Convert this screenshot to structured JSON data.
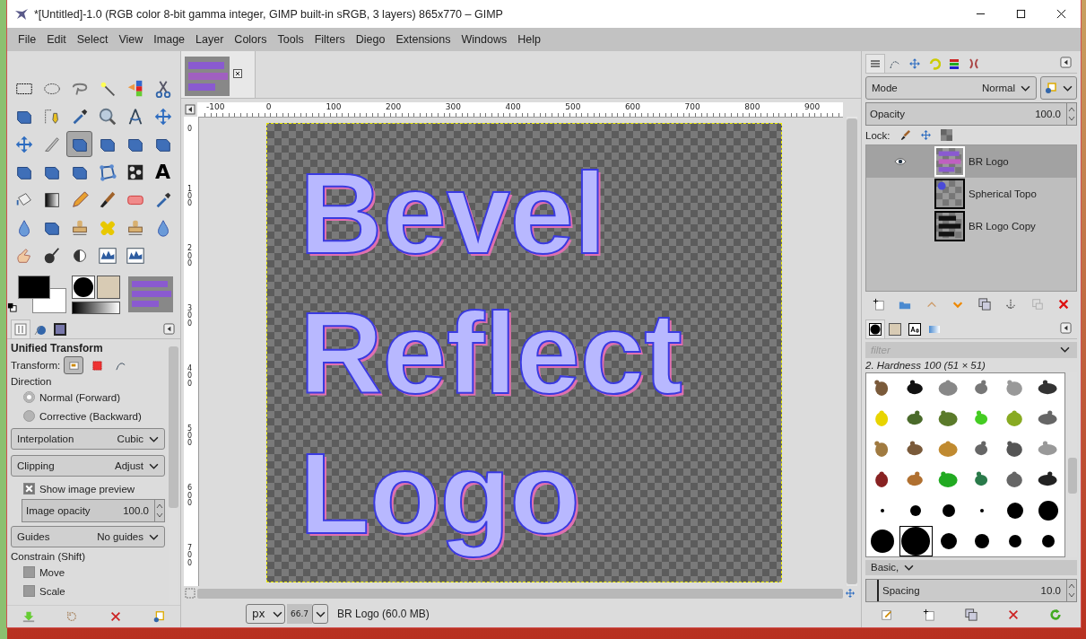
{
  "window": {
    "title": "*[Untitled]-1.0 (RGB color 8-bit gamma integer, GIMP built-in sRGB, 3 layers) 865x770 – GIMP"
  },
  "menu": [
    "File",
    "Edit",
    "Select",
    "View",
    "Image",
    "Layer",
    "Colors",
    "Tools",
    "Filters",
    "Diego",
    "Extensions",
    "Windows",
    "Help"
  ],
  "toolbox": {
    "tools": [
      {
        "selected": false
      },
      {
        "selected": false
      },
      {
        "selected": false
      },
      {
        "selected": false
      },
      {
        "selected": false
      },
      {
        "selected": false
      },
      {
        "selected": false
      },
      {
        "selected": false
      },
      {
        "selected": false
      },
      {
        "selected": false
      },
      {
        "selected": false
      },
      {
        "selected": false
      },
      {
        "selected": false
      },
      {
        "selected": false
      },
      {
        "selected": true
      },
      {
        "selected": false
      },
      {
        "selected": false
      },
      {
        "selected": false
      },
      {
        "selected": false
      },
      {
        "selected": false
      },
      {
        "selected": false
      },
      {
        "selected": false
      },
      {
        "selected": false
      },
      {
        "selected": false,
        "label": "A"
      },
      {
        "selected": false
      },
      {
        "selected": false
      },
      {
        "selected": false
      },
      {
        "selected": false
      },
      {
        "selected": false
      },
      {
        "selected": false
      },
      {
        "selected": false
      },
      {
        "selected": false
      },
      {
        "selected": false
      },
      {
        "selected": false
      },
      {
        "selected": false
      },
      {
        "selected": false
      },
      {
        "selected": false
      },
      {
        "selected": false
      },
      {
        "selected": false
      },
      {
        "selected": false
      },
      {
        "selected": false
      }
    ]
  },
  "tool_options": {
    "tabs": [
      {
        "selected": true
      },
      {
        "selected": false
      },
      {
        "selected": false
      }
    ],
    "title": "Unified Transform",
    "transform_label": "Transform:",
    "transform_modes": [
      {
        "selected": true
      },
      {
        "selected": false
      },
      {
        "selected": false
      }
    ],
    "direction_label": "Direction",
    "direction_options": [
      {
        "label": "Normal (Forward)",
        "selected": true
      },
      {
        "label": "Corrective (Backward)",
        "selected": false
      }
    ],
    "interpolation": {
      "label": "Interpolation",
      "value": "Cubic"
    },
    "clipping": {
      "label": "Clipping",
      "value": "Adjust"
    },
    "show_preview": {
      "label": "Show image preview",
      "checked": true
    },
    "image_opacity": {
      "label": "Image opacity",
      "value": "100.0"
    },
    "guides": {
      "label": "Guides",
      "value": "No guides"
    },
    "constrain_label": "Constrain (Shift)",
    "constrain": [
      {
        "label": "Move",
        "checked": false
      },
      {
        "label": "Scale",
        "checked": false
      }
    ]
  },
  "rulers": {
    "horizontal": [
      "-100",
      "0",
      "100",
      "200",
      "300",
      "400",
      "500",
      "600",
      "700",
      "800",
      "900"
    ],
    "vertical": [
      "0",
      "100",
      "200",
      "300",
      "400",
      "500",
      "600",
      "700"
    ]
  },
  "canvas": {
    "lines": [
      "Bevel",
      "Reflect",
      "Logo"
    ]
  },
  "status_bar": {
    "unit": "px",
    "zoom": "66.7",
    "info": "BR Logo (60.0 MB)"
  },
  "layers_panel": {
    "tabs": [
      {
        "selected": true
      },
      {
        "selected": false
      },
      {
        "selected": false
      },
      {
        "selected": false
      },
      {
        "selected": false
      },
      {
        "selected": false
      }
    ],
    "mode_label": "Mode",
    "mode": "Normal",
    "opacity_label": "Opacity",
    "opacity": "100.0",
    "lock_label": "Lock:",
    "layers": [
      {
        "name": "BR Logo",
        "visible": true,
        "selected": true,
        "kind": "logo"
      },
      {
        "name": "Spherical Topo",
        "visible": false,
        "selected": false,
        "kind": "sphere"
      },
      {
        "name": "BR Logo Copy",
        "visible": false,
        "selected": false,
        "kind": "mono"
      }
    ]
  },
  "brushes_panel": {
    "tabs": [
      {
        "selected": true
      },
      {
        "selected": false
      },
      {
        "selected": false
      },
      {
        "selected": false
      }
    ],
    "filter_placeholder": "filter",
    "current": "2. Hardness 100 (51 × 51)",
    "brushes": [
      {
        "selected": false
      },
      {
        "selected": false
      },
      {
        "selected": false
      },
      {
        "selected": false
      },
      {
        "selected": false
      },
      {
        "selected": false
      },
      {
        "selected": false
      },
      {
        "selected": false
      },
      {
        "selected": false
      },
      {
        "selected": false
      },
      {
        "selected": false
      },
      {
        "selected": false
      },
      {
        "selected": false
      },
      {
        "selected": false
      },
      {
        "selected": false
      },
      {
        "selected": false
      },
      {
        "selected": false
      },
      {
        "selected": false
      },
      {
        "selected": false
      },
      {
        "selected": false
      },
      {
        "selected": false
      },
      {
        "selected": false
      },
      {
        "selected": false
      },
      {
        "selected": false
      },
      {
        "selected": false
      },
      {
        "selected": false
      },
      {
        "selected": false
      },
      {
        "selected": false
      },
      {
        "selected": false
      },
      {
        "selected": false
      },
      {
        "selected": false
      },
      {
        "selected": true
      },
      {
        "selected": false
      },
      {
        "selected": false
      },
      {
        "selected": false
      },
      {
        "selected": false
      }
    ],
    "tag": "Basic,",
    "spacing": {
      "label": "Spacing",
      "value": "10.0",
      "level": 0.05
    }
  }
}
